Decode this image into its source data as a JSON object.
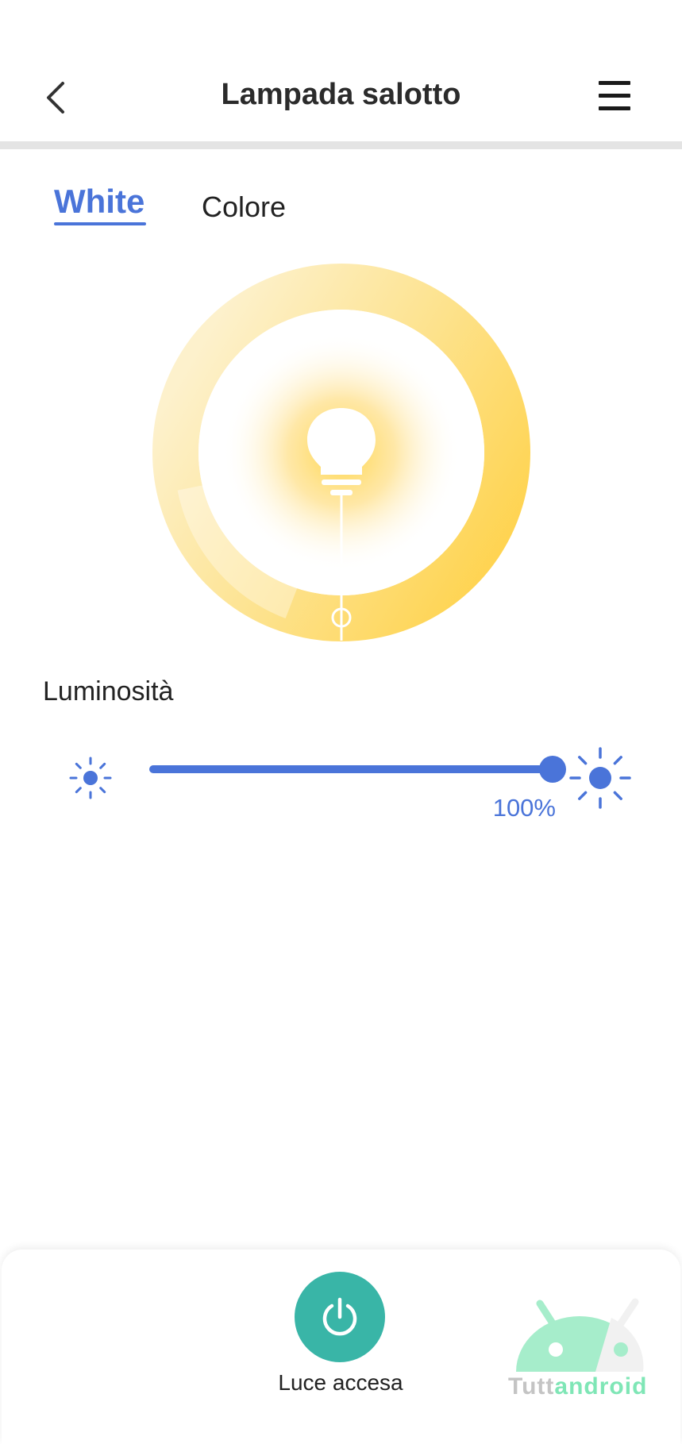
{
  "header": {
    "title": "Lampada salotto",
    "back_icon": "chevron-left-icon",
    "menu_icon": "hamburger-menu-icon"
  },
  "tabs": [
    {
      "label": "White",
      "active": true
    },
    {
      "label": "Colore",
      "active": false
    }
  ],
  "color_temperature": {
    "icon": "lightbulb-icon",
    "ring_colors": [
      "#fdf1cc",
      "#fde28c",
      "#ffd24a"
    ]
  },
  "brightness": {
    "label": "Luminosità",
    "value_text": "100%",
    "value_fraction": 1.0,
    "min_icon": "sun-small-icon",
    "max_icon": "sun-large-icon"
  },
  "power": {
    "label": "Luce accesa",
    "icon": "power-icon",
    "color": "#39b5a7"
  },
  "watermark": {
    "part1": "Tutt",
    "part2": "android"
  },
  "colors": {
    "accent": "#4a74d9",
    "power": "#39b5a7"
  }
}
